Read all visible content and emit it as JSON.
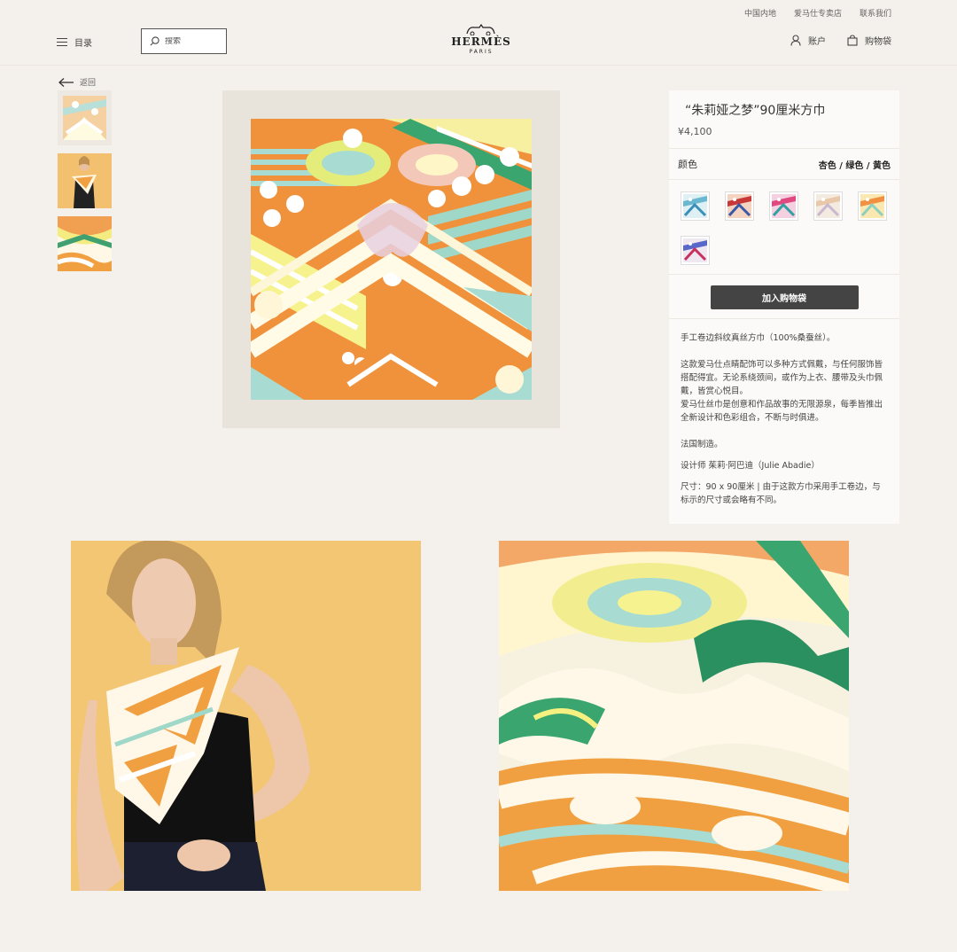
{
  "util_links": [
    "中国内地",
    "爱马仕专卖店",
    "联系我们"
  ],
  "header": {
    "menu_label": "目录",
    "search_placeholder": "搜索",
    "logo_brand": "HERMÈS",
    "logo_city": "PARIS",
    "account_label": "账户",
    "bag_label": "购物袋"
  },
  "back_label": "返回",
  "product": {
    "title": "“朱莉娅之梦”90厘米方巾",
    "price": "¥4,100",
    "color_label": "颜色",
    "selected_color": "杏色 / 绿色 / 黄色",
    "add_to_bag": "加入购物袋",
    "description": [
      "手工卷边斜纹真丝方巾（100%桑蚕丝）。",
      "",
      "这款爱马仕点睛配饰可以多种方式佩戴，与任何服饰皆搭配得宜。无论系绕颈间，或作为上衣、腰带及头巾佩戴，皆赏心悦目。",
      "爱马仕丝巾是创意和作品故事的无限源泉，每季皆推出全新设计和色彩组合，不断与时俱进。",
      "",
      "法国制造。",
      "设计师 茱莉·阿巴迪（Julie Abadie）",
      "尺寸：90 x 90厘米 | 由于这款方巾采用手工卷边，与标示的尺寸或会略有不同。"
    ]
  },
  "swatch_colors": [
    "#8fc8d8",
    "#c84040",
    "#e0608a",
    "#e8d8c0",
    "#f0c050",
    "#6070c8"
  ],
  "colors": {
    "background": "#f4f0eb",
    "panel": "#fbfaf8",
    "button": "#444444",
    "scarf_orange": "#f0913c",
    "scarf_mint": "#9fd8c8",
    "scarf_yellow": "#f2ee8a",
    "scarf_green": "#3aa56e"
  }
}
